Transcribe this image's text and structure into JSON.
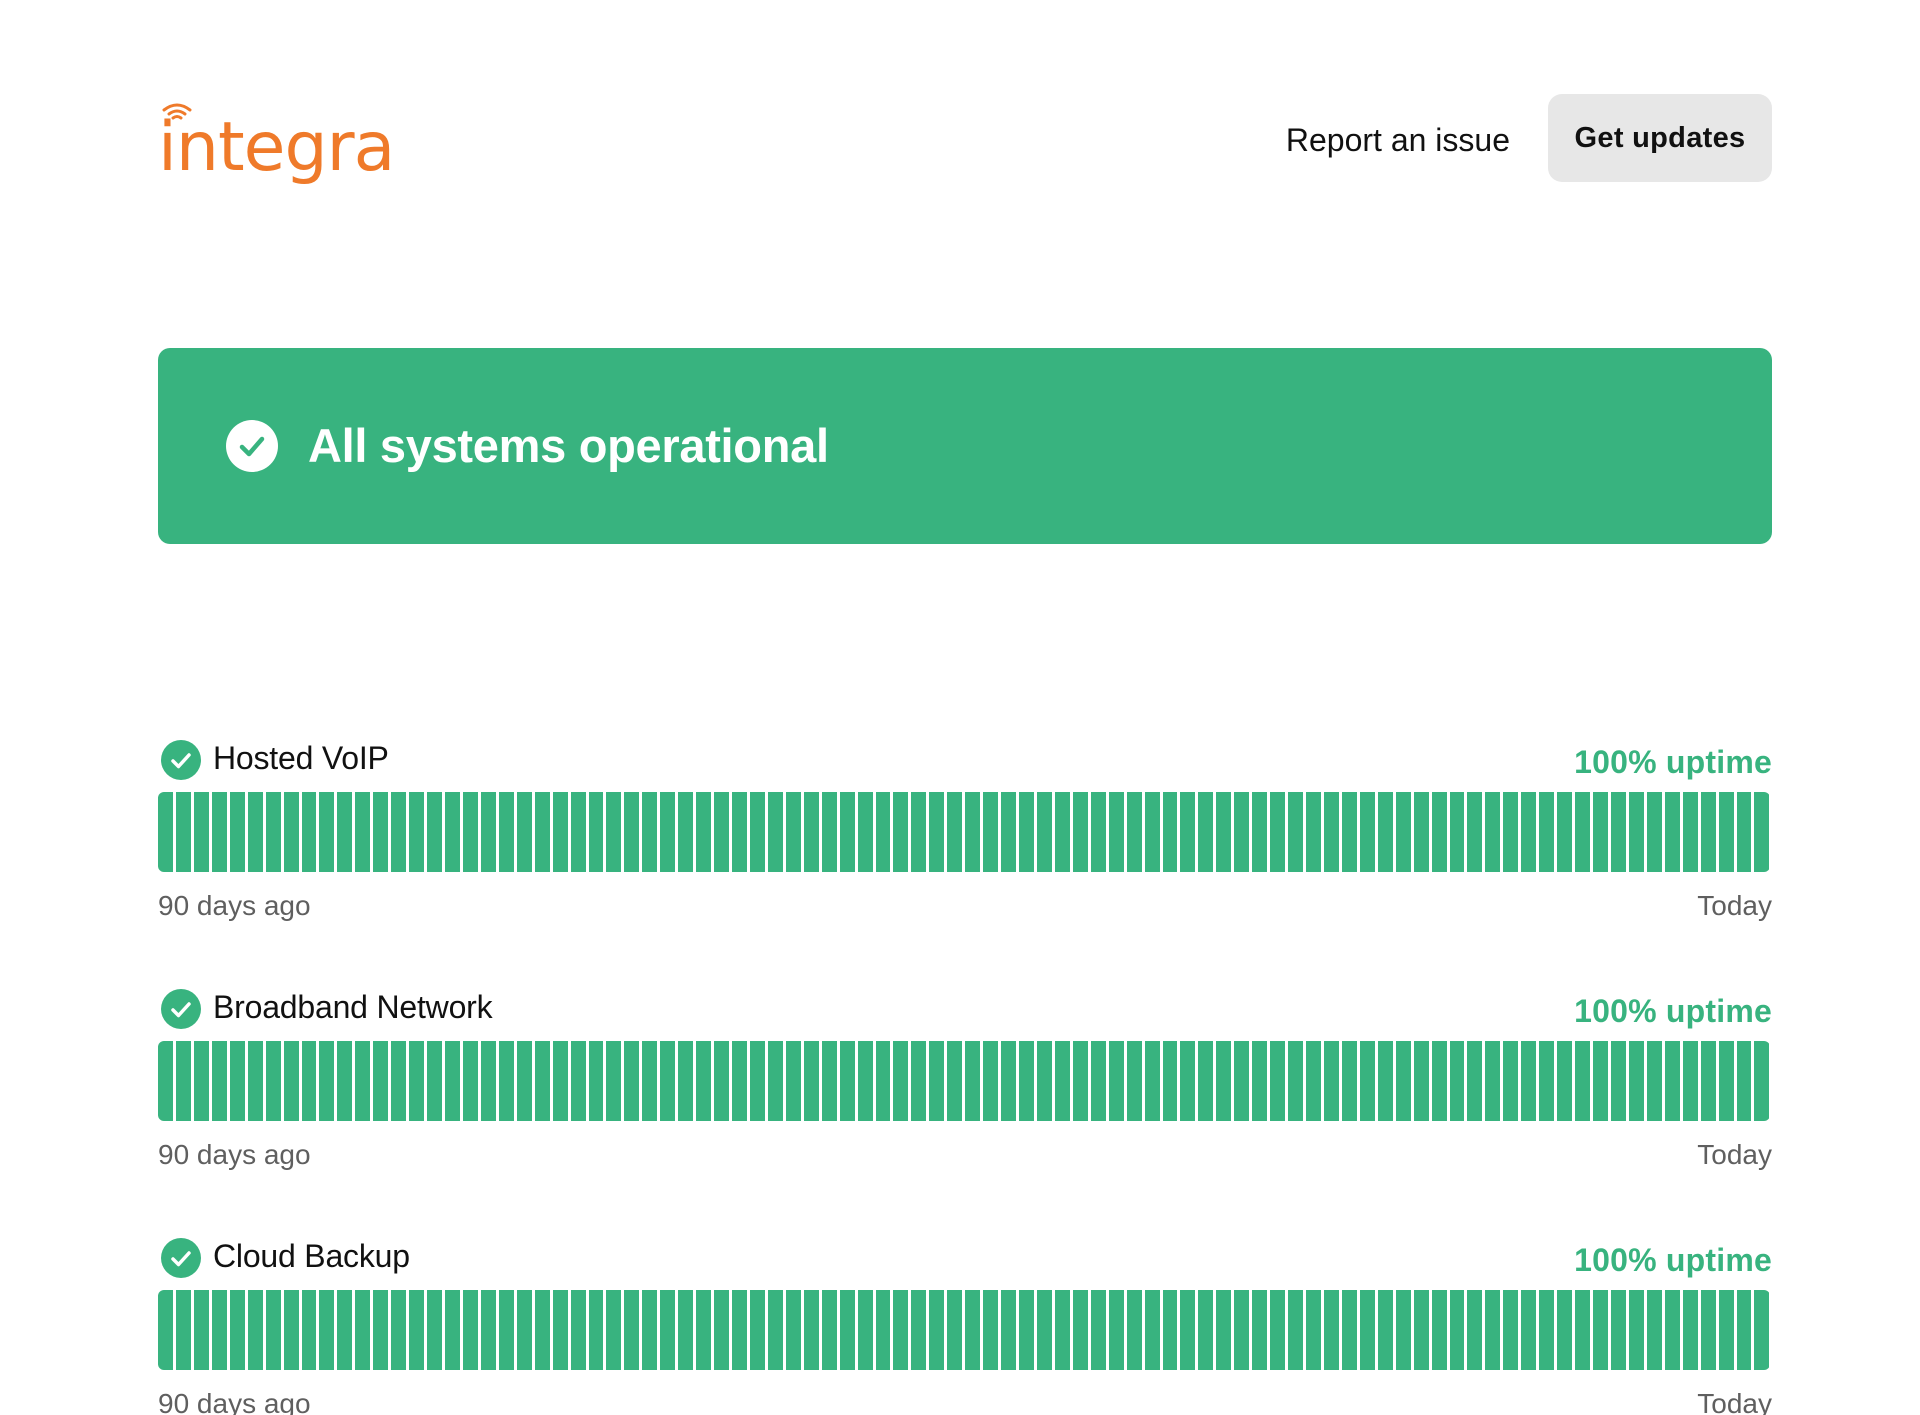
{
  "header": {
    "logo_text": "integra",
    "report_label": "Report an issue",
    "updates_label": "Get updates"
  },
  "banner": {
    "message": "All systems operational",
    "color": "#38b37f"
  },
  "colors": {
    "brand_orange": "#ef7a2a",
    "operational_green": "#38b37f",
    "button_grey": "#e7e7e7"
  },
  "components": [
    {
      "name": "Hosted VoIP",
      "uptime": "100% uptime",
      "range_start": "90 days ago",
      "range_end": "Today",
      "days": 90
    },
    {
      "name": "Broadband Network",
      "uptime": "100% uptime",
      "range_start": "90 days ago",
      "range_end": "Today",
      "days": 90
    },
    {
      "name": "Cloud Backup",
      "uptime": "100% uptime",
      "range_start": "90 days ago",
      "range_end": "Today",
      "days": 90
    }
  ]
}
